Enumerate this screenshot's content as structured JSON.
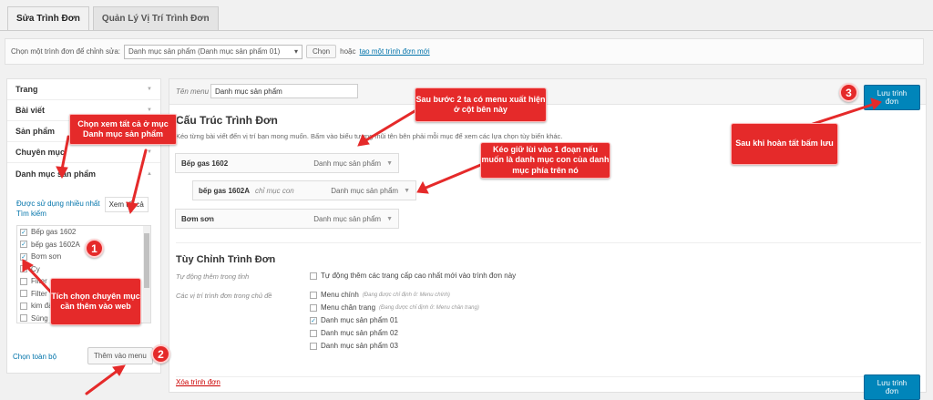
{
  "tabs": [
    "Sửa Trình Đơn",
    "Quản Lý Vị Trí Trình Đơn"
  ],
  "selectbar": {
    "label": "Chọn một trình đơn để chỉnh sửa:",
    "selected": "Danh mục sản phẩm (Danh mục sản phẩm 01)",
    "choose_button": "Chọn",
    "or_text": "hoặc",
    "create_link": "tạo một trình đơn mới"
  },
  "left": {
    "sections": [
      "Trang",
      "Bài viết",
      "Sản phẩm",
      "Chuyên mục",
      "Danh mục sản phẩm"
    ],
    "sub_most_used": "Được sử dụng nhiều nhất",
    "sub_search": "Tìm kiếm",
    "sub_view_all": "Xem tất cả",
    "items": [
      {
        "label": "Bếp gas 1602",
        "checked": true
      },
      {
        "label": "bếp gas 1602A",
        "checked": true
      },
      {
        "label": "Bơm sơn",
        "checked": true
      },
      {
        "label": "Cy",
        "checked": false
      },
      {
        "label": "Filter",
        "checked": false
      },
      {
        "label": "Filter",
        "checked": false
      },
      {
        "label": "kim đả",
        "checked": false
      },
      {
        "label": "Súng sơn tĩnh điện",
        "checked": false
      }
    ],
    "select_all": "Chọn toàn bộ",
    "add_button": "Thêm vào menu"
  },
  "main": {
    "name_label": "Tên menu",
    "name_value": "Danh mục sản phẩm",
    "save_label": "Lưu trình đơn",
    "structure_title": "Cấu Trúc Trình Đơn",
    "structure_desc": "Kéo từng bài viết đến vị trí bạn mong muốn. Bấm vào biểu tượng mũi tên bên phải mỗi mục để xem các lựa chọn tùy biến khác.",
    "menu_items": [
      {
        "label": "Bếp gas 1602",
        "sub": "",
        "type": "Danh mục sản phẩm"
      },
      {
        "label": "bếp gas 1602A",
        "sub": "chỉ mục con",
        "type": "Danh mục sản phẩm"
      },
      {
        "label": "Bơm sơn",
        "sub": "",
        "type": "Danh mục sản phẩm"
      }
    ],
    "settings_title": "Tùy Chỉnh Trình Đơn",
    "auto_add_label": "Tự động thêm trong tỉnh",
    "auto_add_text": "Tự động thêm các trang cấp cao nhất mới vào trình đơn này",
    "locations_label": "Các vị trí trình đơn trong chủ đề",
    "locations": [
      {
        "label": "Menu chính",
        "note": "(Đang được chỉ định ở: Menu chính)",
        "checked": false
      },
      {
        "label": "Menu chân trang",
        "note": "(Đang được chỉ định ở: Menu chân trang)",
        "checked": false
      },
      {
        "label": "Danh mục sản phẩm 01",
        "note": "",
        "checked": true
      },
      {
        "label": "Danh mục sản phẩm 02",
        "note": "",
        "checked": false
      },
      {
        "label": "Danh mục sản phẩm 03",
        "note": "",
        "checked": false
      }
    ],
    "delete_link": "Xóa trình đơn"
  },
  "annotations": {
    "a1": "Chọn xem tất cả ở mục Danh mục sản phẩm",
    "a2": "Sau bước 2 ta có menu xuất hiện ở cột bên này",
    "a3": "Kéo giữ lùi vào 1 đoạn nếu muốn là danh mục con của danh mục phía trên nó",
    "a4": "Sau khi hoàn tất bấm lưu",
    "a5": "Tích chọn chuyên mục cần thêm vào web",
    "n1": "1",
    "n2": "2",
    "n3": "3"
  },
  "colors": {
    "accent": "#0085ba",
    "annotation": "#e52a2a"
  }
}
